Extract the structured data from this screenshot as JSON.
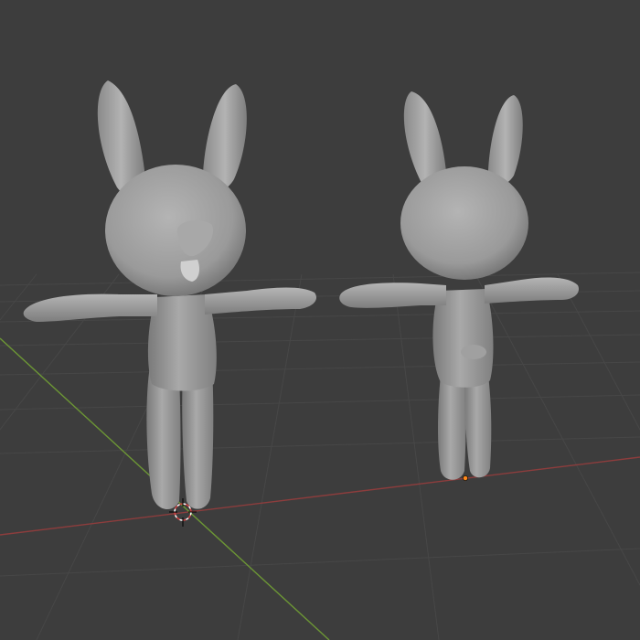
{
  "viewport": {
    "background": "#3d3d3d",
    "grid_color": "#4a4a4a",
    "x_axis_color": "#9b3f3f",
    "y_axis_color": "#6e9a3a",
    "mesh_color": "#9c9c9c",
    "mesh_shadow": "#6b6b6b",
    "mesh_highlight": "#bdbdbd",
    "cursor_color": "#d04040",
    "origin_color": "#ff8a1a"
  },
  "objects": [
    {
      "name": "rabbit-front-view",
      "icon": "rabbit-mesh-icon"
    },
    {
      "name": "rabbit-back-view",
      "icon": "rabbit-mesh-icon"
    }
  ]
}
